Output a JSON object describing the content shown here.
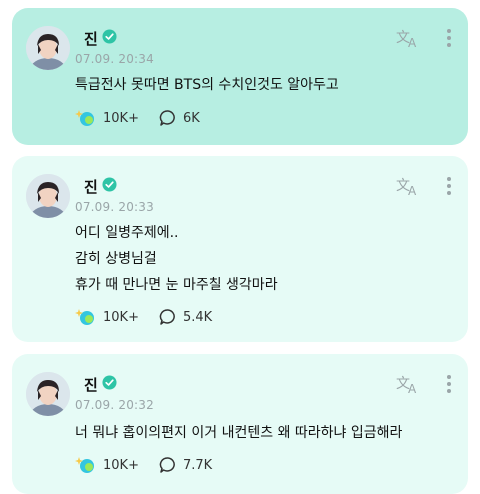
{
  "posts": [
    {
      "author": "진",
      "timestamp": "07.09. 20:34",
      "lines": [
        "특급전사 못따면 BTS의 수치인것도 알아두고"
      ],
      "likes": "10K+",
      "comments": "6K",
      "highlighted": true
    },
    {
      "author": "진",
      "timestamp": "07.09. 20:33",
      "lines": [
        "어디 일병주제에..",
        "감히 상병님걸",
        "휴가 때 만나면 눈 마주칠 생각마라"
      ],
      "likes": "10K+",
      "comments": "5.4K",
      "highlighted": false
    },
    {
      "author": "진",
      "timestamp": "07.09. 20:32",
      "lines": [
        "너 뭐냐 홉이의편지 이거 내컨텐츠 왜 따라하냐 입금해라"
      ],
      "likes": "10K+",
      "comments": "7.7K",
      "highlighted": false
    }
  ],
  "colors": {
    "highlight_card": "#b7eee2",
    "normal_card": "#e6fbf6",
    "verified_badge": "#2ec4a6",
    "timestamp": "#9aa5a8"
  },
  "icons": {
    "verified": "verified-badge-icon",
    "translate": "translate-icon",
    "more": "more-vertical-icon",
    "like": "sparkle-heart-icon",
    "comment": "comment-bubble-icon"
  }
}
